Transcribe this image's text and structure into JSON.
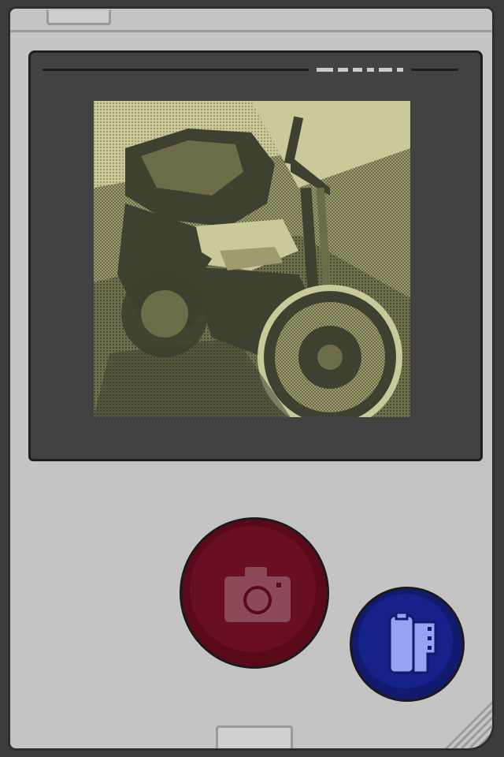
{
  "device": {
    "brand_label": "",
    "body_color": "#c4c4c4",
    "screen_bezel_color": "#424242"
  },
  "viewfinder": {
    "image_description_icon": "photo-preview",
    "palette": [
      "#c9c99a",
      "#9c9c6e",
      "#6c6c48",
      "#3e4030"
    ]
  },
  "controls": {
    "shutter_icon": "camera-icon",
    "shutter_color": "#5a0919",
    "gallery_icon": "film-roll-icon",
    "gallery_color": "#121a6e"
  }
}
